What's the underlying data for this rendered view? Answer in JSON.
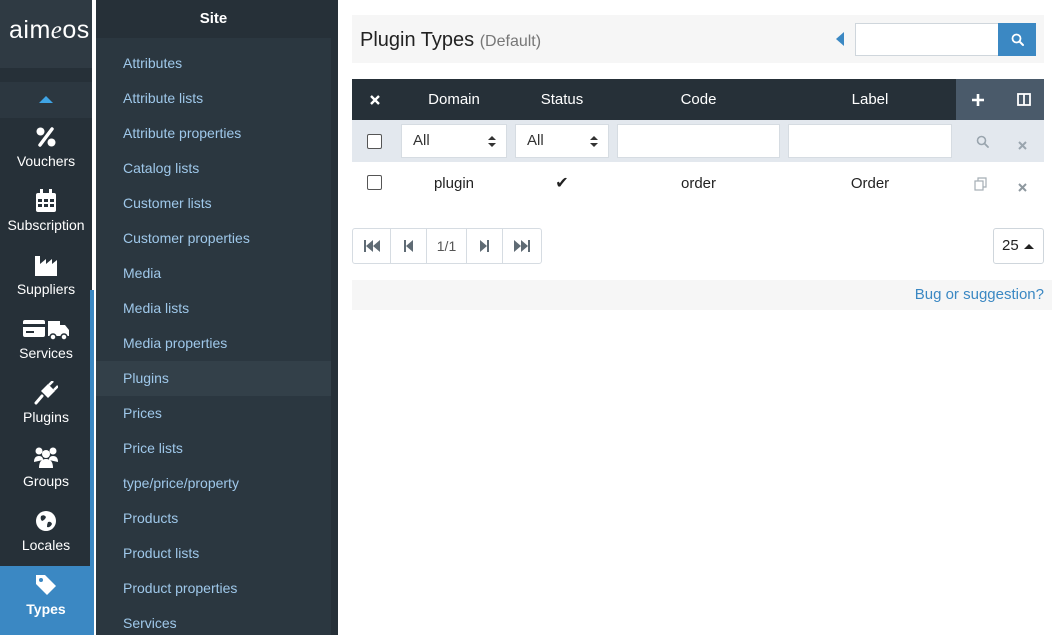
{
  "brand": {
    "name_prefix": "aim",
    "name_accent": "e",
    "name_suffix": "os"
  },
  "rail": {
    "items": [
      {
        "label": "Vouchers",
        "icon": "percent-icon"
      },
      {
        "label": "Subscription",
        "icon": "calendar-icon"
      },
      {
        "label": "Suppliers",
        "icon": "factory-icon"
      },
      {
        "label": "Services",
        "icon": "truck-icon"
      },
      {
        "label": "Plugins",
        "icon": "plug-icon"
      },
      {
        "label": "Groups",
        "icon": "users-icon"
      },
      {
        "label": "Locales",
        "icon": "globe-icon"
      },
      {
        "label": "Types",
        "icon": "tag-icon",
        "active": true
      }
    ]
  },
  "subnav": {
    "title": "Site",
    "items": [
      "Attributes",
      "Attribute lists",
      "Attribute properties",
      "Catalog lists",
      "Customer lists",
      "Customer properties",
      "Media",
      "Media lists",
      "Media properties",
      "Plugins",
      "Prices",
      "Price lists",
      "type/price/property",
      "Products",
      "Product lists",
      "Product properties",
      "Services"
    ],
    "active": "Plugins"
  },
  "header": {
    "title": "Plugin Types",
    "subtitle": "(Default)",
    "search_value": ""
  },
  "table": {
    "columns": [
      "Domain",
      "Status",
      "Code",
      "Label"
    ],
    "filters": {
      "domain": "All",
      "status": "All",
      "code": "",
      "label": ""
    },
    "rows": [
      {
        "domain": "plugin",
        "status": "✔",
        "code": "order",
        "label": "Order"
      }
    ]
  },
  "pager": {
    "page": "1/1",
    "page_size": "25"
  },
  "footer": {
    "link": "Bug or suggestion?"
  },
  "colors": {
    "accent": "#3b88c3",
    "rail_bg": "#263038",
    "sub_bg": "#2b3740",
    "link": "#9fc8ea"
  }
}
